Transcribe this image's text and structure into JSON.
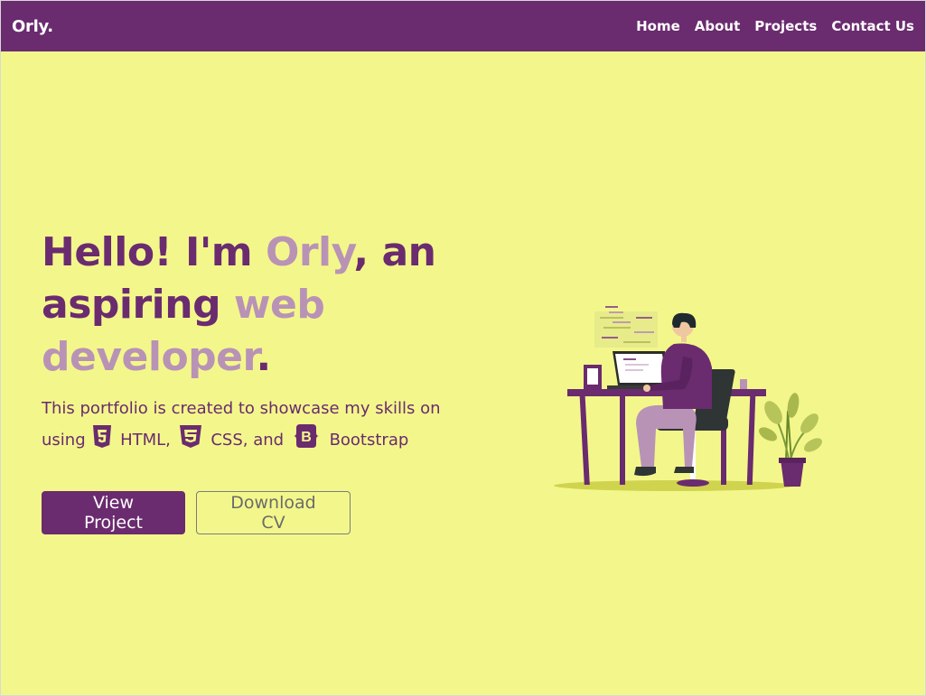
{
  "nav": {
    "brand": "Orly.",
    "links": [
      "Home",
      "About",
      "Projects",
      "Contact Us"
    ]
  },
  "hero": {
    "headline": {
      "p1": "Hello! I'm ",
      "name": "Orly",
      "p2": ", an aspiring ",
      "web": "web",
      "p3": " ",
      "developer": "developer",
      "p4": "."
    },
    "lead": {
      "p1": "This portfolio is created to showcase my skills on using ",
      "html": "HTML,",
      "css": "CSS, and",
      "bootstrap": "Bootstrap"
    },
    "buttons": {
      "primary": "View Project",
      "secondary": "Download CV"
    }
  },
  "colors": {
    "background": "#f3f78b",
    "navbar": "#6a2b6f",
    "accent": "#6a2b6f",
    "accent_light": "#b893b6"
  },
  "icons": {
    "html": "html5-icon",
    "css": "css3-icon",
    "bootstrap": "bootstrap-icon"
  }
}
